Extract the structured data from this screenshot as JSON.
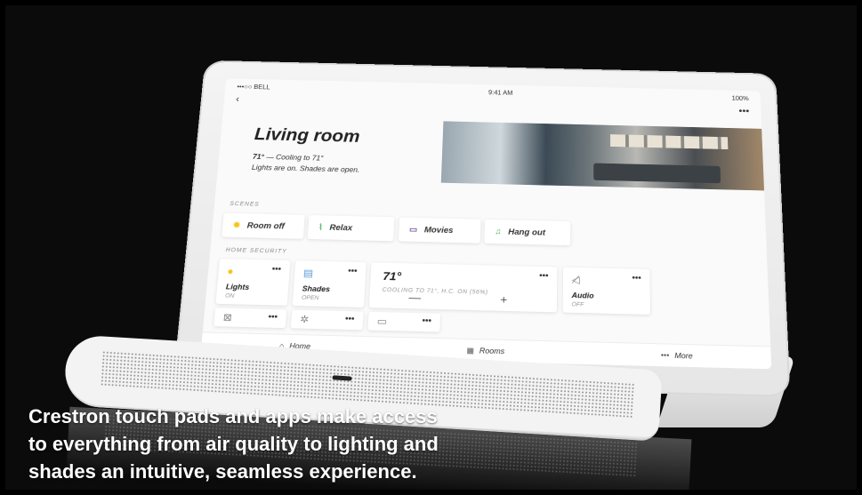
{
  "status_bar": {
    "carrier": "•••○○ BELL",
    "time": "9:41 AM",
    "battery": "100%"
  },
  "nav": {
    "back_glyph": "‹",
    "more_glyph": "•••"
  },
  "room": {
    "title": "Living room",
    "temp_line_strong": "71°",
    "temp_line_rest": " — Cooling to 71°",
    "status_line": "Lights are on. Shades are open."
  },
  "scenes_label": "SCENES",
  "scenes": [
    {
      "label": "Room off",
      "icon": "sun-icon"
    },
    {
      "label": "Relax",
      "icon": "lounge-icon"
    },
    {
      "label": "Movies",
      "icon": "tv-icon"
    },
    {
      "label": "Hang out",
      "icon": "music-icon"
    }
  ],
  "devices_label": "HOME SECURITY",
  "devices": {
    "lights": {
      "name": "Lights",
      "state": "ON",
      "icon": "bulb-icon"
    },
    "shades": {
      "name": "Shades",
      "state": "OPEN",
      "icon": "shade-icon"
    },
    "thermostat": {
      "value": "71°",
      "desc": "COOLING TO 71°, H.C. ON (56%)",
      "minus": "—",
      "plus": "+"
    },
    "audio": {
      "name": "Audio",
      "state": "OFF",
      "icon": "speaker-off-icon"
    }
  },
  "row3_icons": [
    "camera-off-icon",
    "fan-icon",
    "tv-icon"
  ],
  "more_glyph": "•••",
  "tabs": [
    {
      "label": "Home",
      "icon": "home-icon"
    },
    {
      "label": "Rooms",
      "icon": "rooms-icon"
    },
    {
      "label": "More",
      "icon": "more-icon"
    }
  ],
  "brand": "CRESTRON",
  "caption": {
    "line1": "Crestron touch pads and apps make access",
    "line2": "to everything from air quality to lighting and",
    "line3": "shades an intuitive, seamless experience."
  },
  "colors": {
    "background": "#000000",
    "caption": "#ffffff",
    "accent_yellow": "#f5c518",
    "accent_green": "#4caf50"
  }
}
